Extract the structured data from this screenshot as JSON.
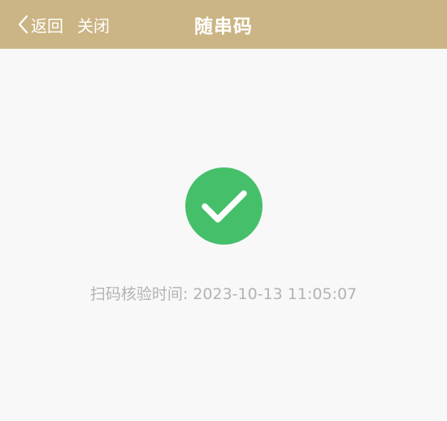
{
  "header": {
    "back_label": "返回",
    "close_label": "关闭",
    "title": "随串码",
    "background_color": "#cbb584"
  },
  "result": {
    "icon": "check-circle-icon",
    "icon_color": "#45bf6a",
    "verify_label": "扫码核验时间: ",
    "verify_time": "2023-10-13 11:05:07",
    "text_color": "#b3b3b3"
  }
}
